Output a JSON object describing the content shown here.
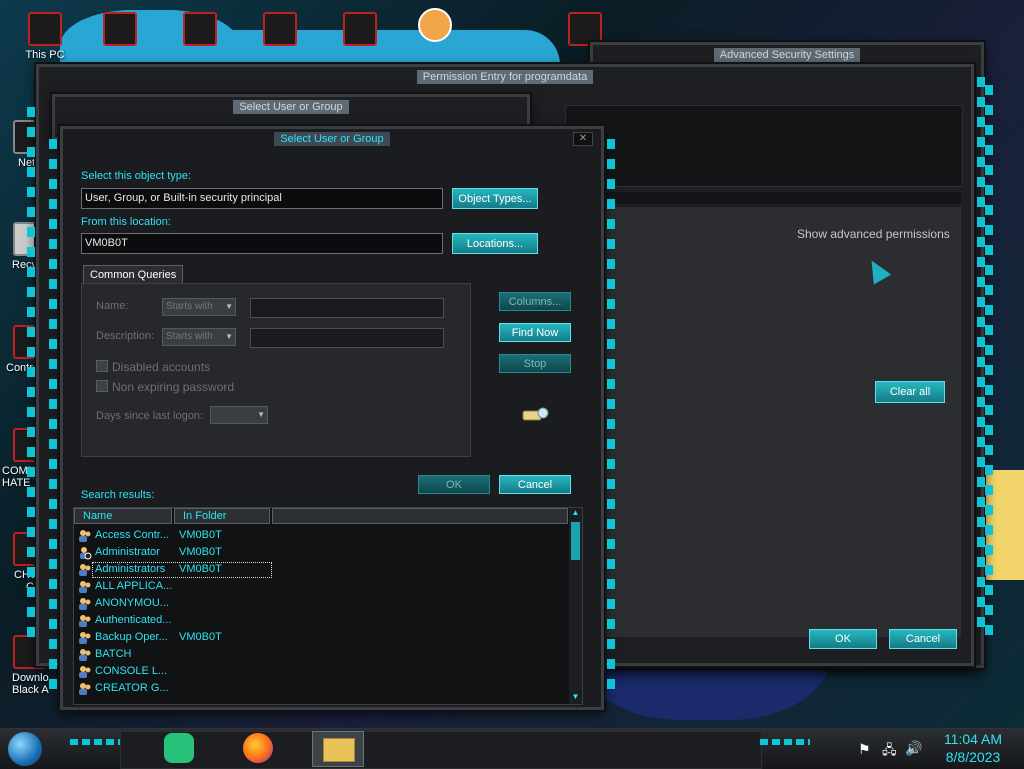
{
  "desktop": {
    "icons": [
      {
        "label": "This PC"
      },
      {
        "label": "Net"
      },
      {
        "label": "Recyc"
      },
      {
        "label": "Contro"
      },
      {
        "label": "COMM"
      },
      {
        "label": "HATE T"
      },
      {
        "label": "CHU"
      },
      {
        "label": "C"
      },
      {
        "label": "Downlo"
      },
      {
        "label": "Black A"
      }
    ]
  },
  "back_window": {
    "title": "Advanced Security Settings",
    "show_advanced": "Show advanced permissions",
    "clear_all": "Clear all",
    "ok": "OK",
    "cancel": "Cancel"
  },
  "perm_window": {
    "title": "Permission Entry for programdata"
  },
  "select_window_back": {
    "title": "Select User or Group"
  },
  "dialog": {
    "title": "Select User or Group",
    "object_type_label": "Select this object type:",
    "object_type_value": "User, Group, or Built-in security principal",
    "object_types_btn": "Object Types...",
    "location_label": "From this location:",
    "location_value": "VM0B0T",
    "locations_btn": "Locations...",
    "tab_common": "Common Queries",
    "name_label": "Name:",
    "desc_label": "Description:",
    "starts_with": "Starts with",
    "disabled_accounts": "Disabled accounts",
    "non_expiring": "Non expiring password",
    "days_since": "Days since last logon:",
    "columns_btn": "Columns...",
    "find_now_btn": "Find Now",
    "stop_btn": "Stop",
    "ok_btn": "OK",
    "cancel_btn": "Cancel",
    "search_results_label": "Search results:",
    "col_name": "Name",
    "col_folder": "In Folder",
    "results": [
      {
        "name": "Access Contr...",
        "folder": "VM0B0T"
      },
      {
        "name": "Administrator",
        "folder": "VM0B0T"
      },
      {
        "name": "Administrators",
        "folder": "VM0B0T"
      },
      {
        "name": "ALL APPLICA...",
        "folder": ""
      },
      {
        "name": "ANONYMOU...",
        "folder": ""
      },
      {
        "name": "Authenticated...",
        "folder": ""
      },
      {
        "name": "Backup Oper...",
        "folder": "VM0B0T"
      },
      {
        "name": "BATCH",
        "folder": ""
      },
      {
        "name": "CONSOLE L...",
        "folder": ""
      },
      {
        "name": "CREATOR G...",
        "folder": ""
      }
    ]
  },
  "taskbar": {
    "time": "11:04 AM",
    "date": "8/8/2023"
  },
  "colors": {
    "accent": "#2fe3f2",
    "button": "#1aa3ad",
    "window_bg": "#1d1f22"
  }
}
